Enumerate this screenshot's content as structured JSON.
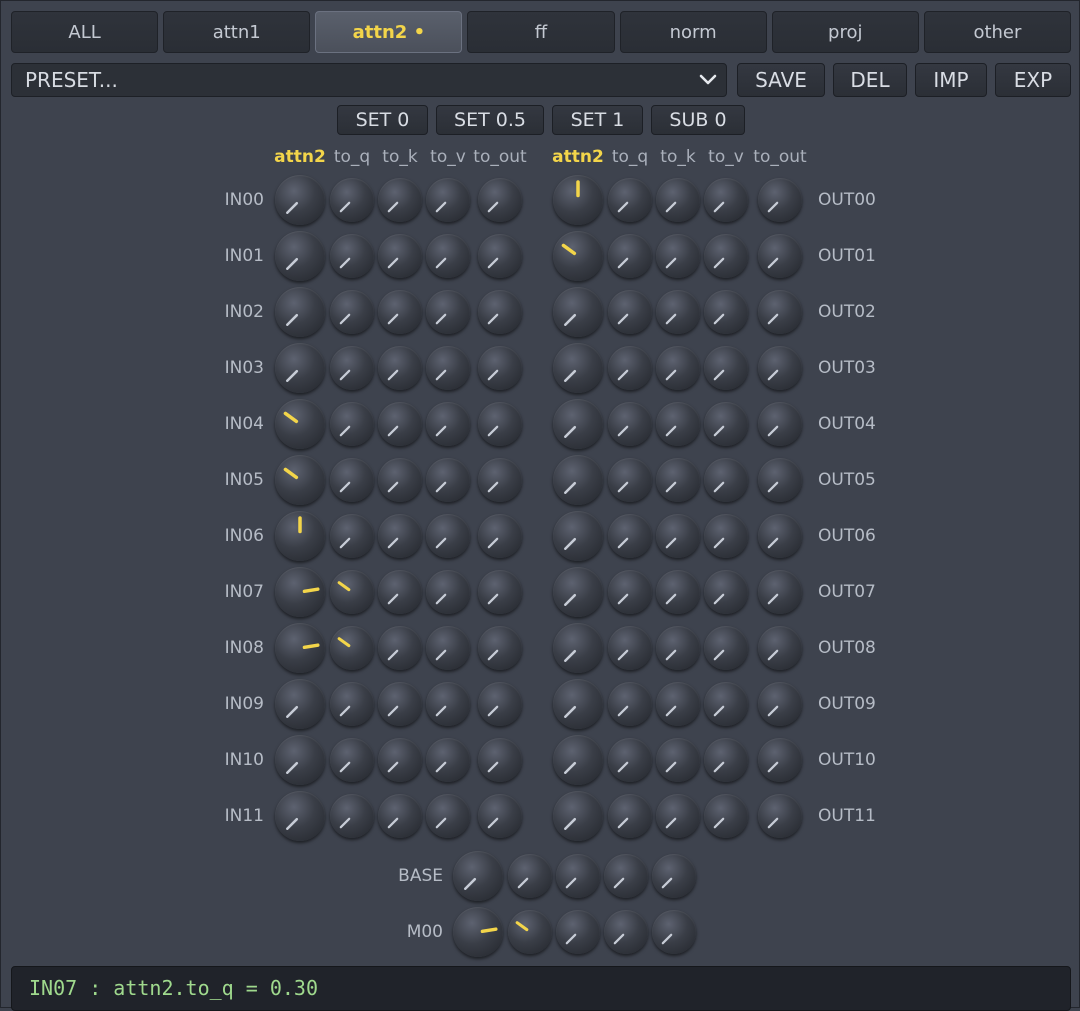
{
  "tabs": [
    {
      "label": "ALL",
      "active": false
    },
    {
      "label": "attn1",
      "active": false
    },
    {
      "label": "attn2 •",
      "active": true
    },
    {
      "label": "ff",
      "active": false
    },
    {
      "label": "norm",
      "active": false
    },
    {
      "label": "proj",
      "active": false
    },
    {
      "label": "other",
      "active": false
    }
  ],
  "preset": {
    "value": "PRESET...",
    "icon": "chevron-down-icon"
  },
  "buttons": {
    "save": "SAVE",
    "del": "DEL",
    "imp": "IMP",
    "exp": "EXP"
  },
  "set_buttons": {
    "set0": "SET 0",
    "set05": "SET 0.5",
    "set1": "SET 1",
    "sub0": "SUB 0"
  },
  "columns": [
    "attn2",
    "to_q",
    "to_k",
    "to_v",
    "to_out"
  ],
  "in_rows": [
    {
      "label": "IN00",
      "values": [
        0,
        0,
        0,
        0,
        0
      ]
    },
    {
      "label": "IN01",
      "values": [
        0,
        0,
        0,
        0,
        0
      ]
    },
    {
      "label": "IN02",
      "values": [
        0,
        0,
        0,
        0,
        0
      ]
    },
    {
      "label": "IN03",
      "values": [
        0,
        0,
        0,
        0,
        0
      ]
    },
    {
      "label": "IN04",
      "values": [
        0.3,
        0,
        0,
        0,
        0
      ]
    },
    {
      "label": "IN05",
      "values": [
        0.3,
        0,
        0,
        0,
        0
      ]
    },
    {
      "label": "IN06",
      "values": [
        0.5,
        0,
        0,
        0,
        0
      ]
    },
    {
      "label": "IN07",
      "values": [
        0.8,
        0.3,
        0,
        0,
        0
      ]
    },
    {
      "label": "IN08",
      "values": [
        0.8,
        0.3,
        0,
        0,
        0
      ]
    },
    {
      "label": "IN09",
      "values": [
        0,
        0,
        0,
        0,
        0
      ]
    },
    {
      "label": "IN10",
      "values": [
        0,
        0,
        0,
        0,
        0
      ]
    },
    {
      "label": "IN11",
      "values": [
        0,
        0,
        0,
        0,
        0
      ]
    }
  ],
  "out_rows": [
    {
      "label": "OUT00",
      "values": [
        0.5,
        0,
        0,
        0,
        0
      ]
    },
    {
      "label": "OUT01",
      "values": [
        0.3,
        0,
        0,
        0,
        0
      ]
    },
    {
      "label": "OUT02",
      "values": [
        0,
        0,
        0,
        0,
        0
      ]
    },
    {
      "label": "OUT03",
      "values": [
        0,
        0,
        0,
        0,
        0
      ]
    },
    {
      "label": "OUT04",
      "values": [
        0,
        0,
        0,
        0,
        0
      ]
    },
    {
      "label": "OUT05",
      "values": [
        0,
        0,
        0,
        0,
        0
      ]
    },
    {
      "label": "OUT06",
      "values": [
        0,
        0,
        0,
        0,
        0
      ]
    },
    {
      "label": "OUT07",
      "values": [
        0,
        0,
        0,
        0,
        0
      ]
    },
    {
      "label": "OUT08",
      "values": [
        0,
        0,
        0,
        0,
        0
      ]
    },
    {
      "label": "OUT09",
      "values": [
        0,
        0,
        0,
        0,
        0
      ]
    },
    {
      "label": "OUT10",
      "values": [
        0,
        0,
        0,
        0,
        0
      ]
    },
    {
      "label": "OUT11",
      "values": [
        0,
        0,
        0,
        0,
        0
      ]
    }
  ],
  "bottom_rows": [
    {
      "label": "BASE",
      "values": [
        0,
        0,
        0,
        0,
        0
      ]
    },
    {
      "label": "M00",
      "values": [
        0.8,
        0.3,
        0,
        0,
        0
      ]
    }
  ],
  "status": "IN07 : attn2.to_q = 0.30",
  "colors": {
    "accent": "#f3d54a",
    "indicator_zero": "#c7ccd6",
    "status_text": "#9fd98d"
  }
}
